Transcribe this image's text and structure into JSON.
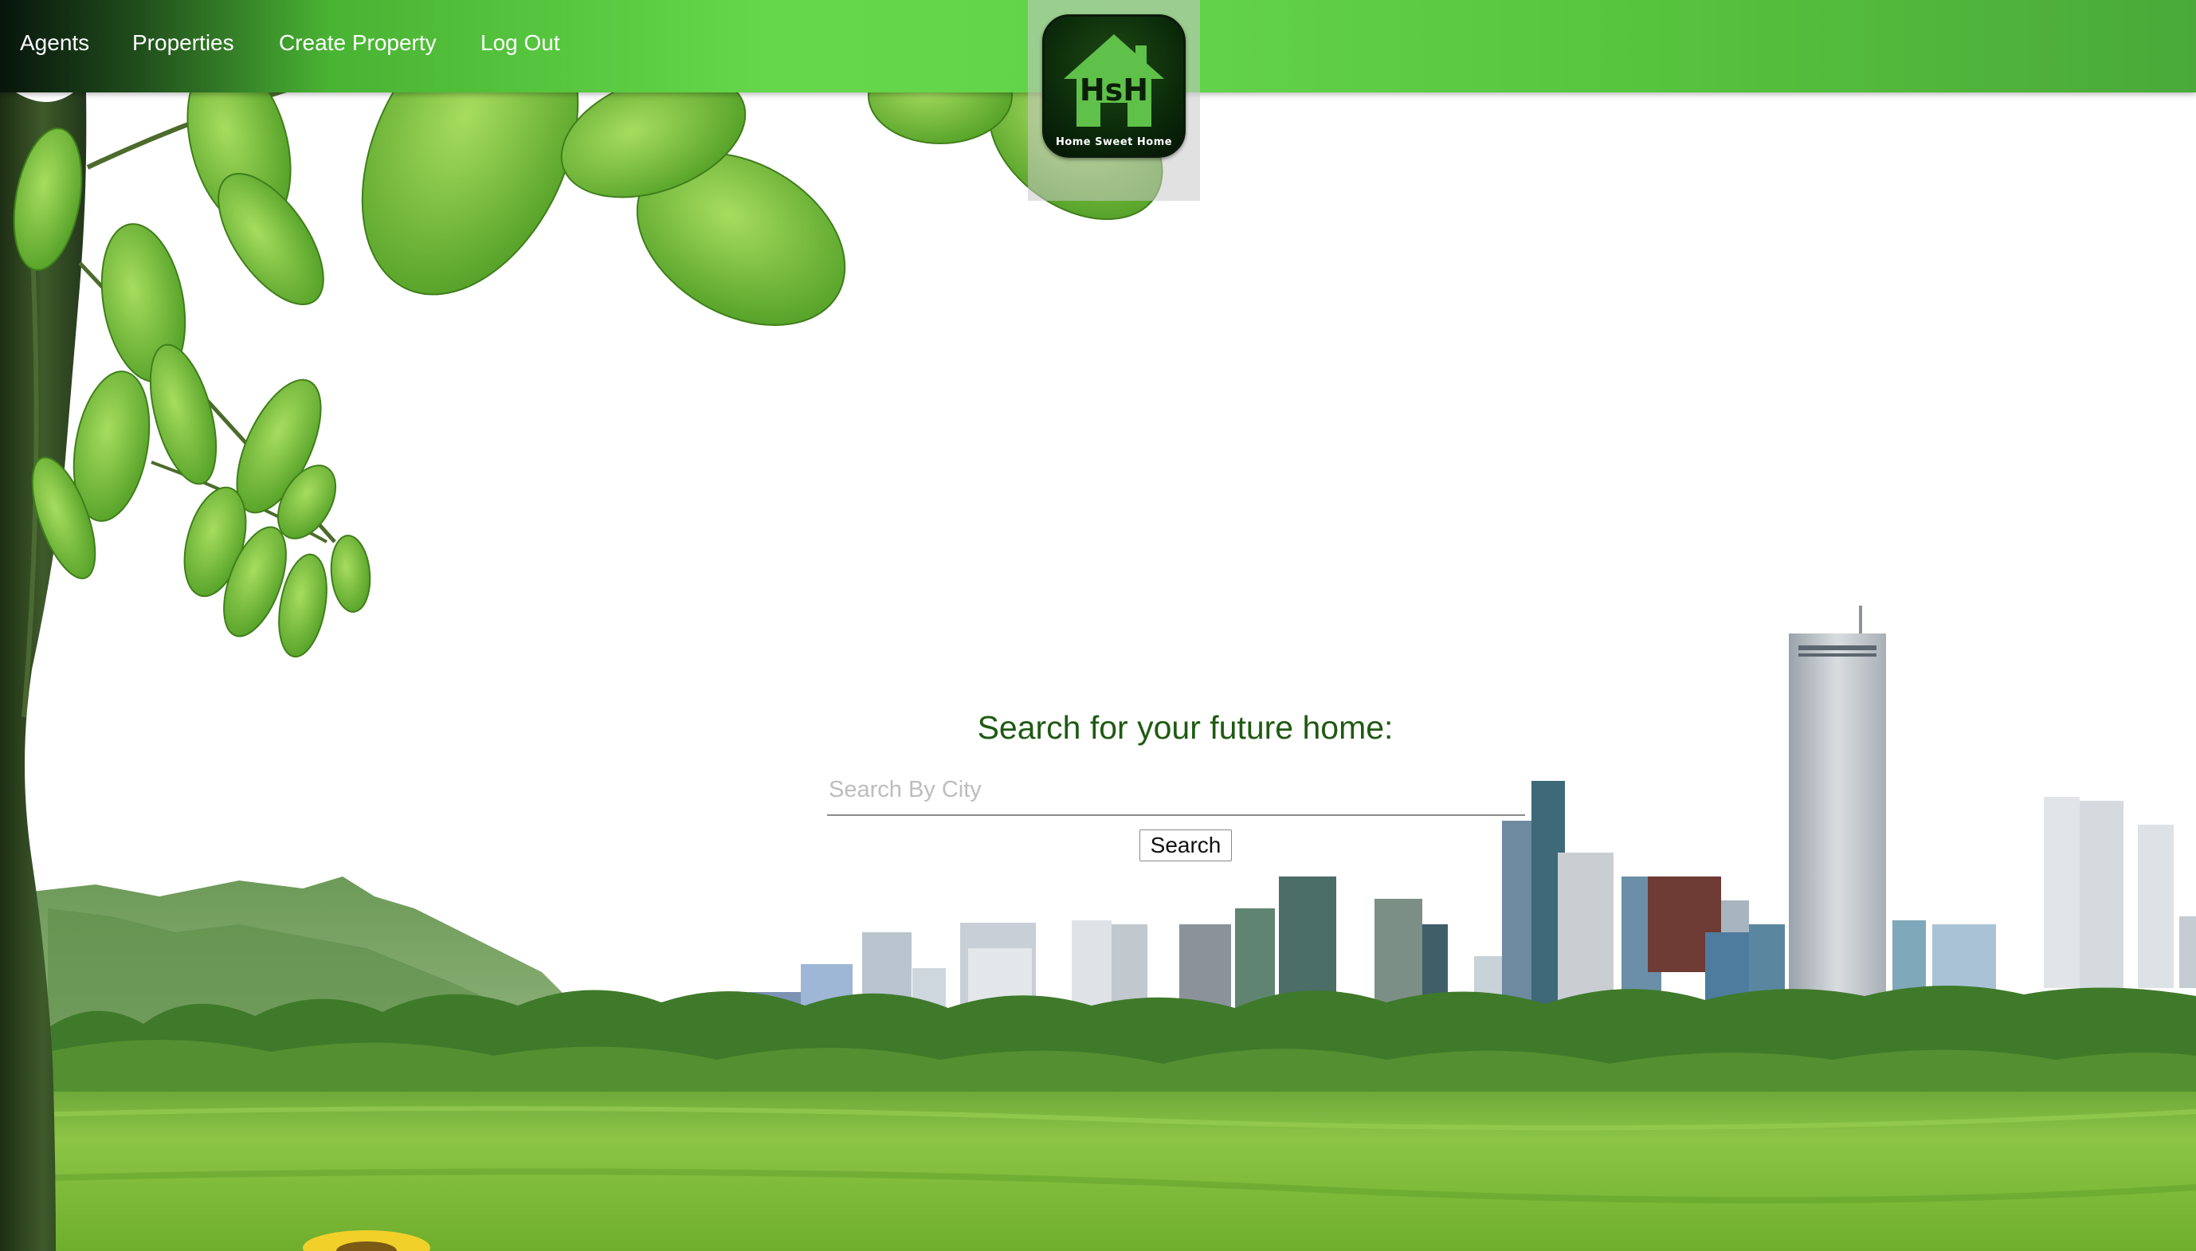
{
  "nav": {
    "items": [
      {
        "label": "Agents"
      },
      {
        "label": "Properties"
      },
      {
        "label": "Create Property"
      },
      {
        "label": "Log Out"
      }
    ]
  },
  "logo": {
    "text": "HsH",
    "tagline": "Home Sweet Home"
  },
  "search": {
    "heading": "Search for your future home:",
    "placeholder": "Search By City",
    "value": "",
    "button_label": "Search"
  },
  "colors": {
    "nav_green": "#64d84a",
    "heading_green": "#1f5a12",
    "grass": "#7fbf3a"
  }
}
